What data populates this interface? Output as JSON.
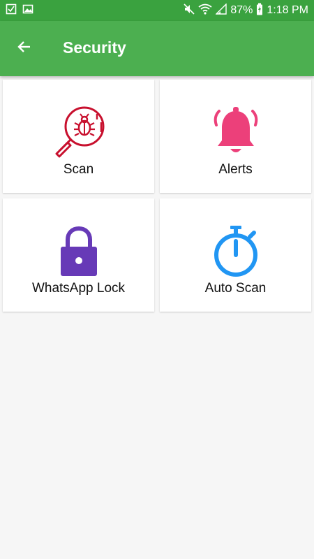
{
  "status_bar": {
    "battery": "87%",
    "time": "1:18 PM",
    "icons": [
      "checkbox-icon",
      "image-icon",
      "mute-icon",
      "wifi-icon",
      "signal-icon",
      "battery-charging-icon"
    ]
  },
  "app_bar": {
    "title": "Security",
    "back_icon": "arrow-left-icon"
  },
  "tiles": [
    {
      "label": "Scan",
      "icon": "bug-scan-icon",
      "color": "#c8102e"
    },
    {
      "label": "Alerts",
      "icon": "bell-icon",
      "color": "#ec407a"
    },
    {
      "label": "WhatsApp Lock",
      "icon": "lock-icon",
      "color": "#673ab7"
    },
    {
      "label": "Auto Scan",
      "icon": "stopwatch-icon",
      "color": "#2196f3"
    }
  ],
  "colors": {
    "status_bar": "#3aa23f",
    "app_bar": "#4caf50",
    "background": "#f6f6f6"
  }
}
